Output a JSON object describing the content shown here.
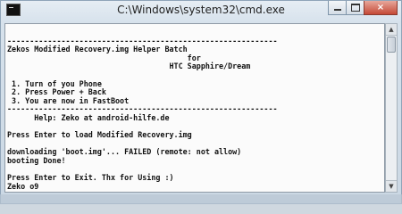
{
  "window": {
    "title": "C:\\Windows\\system32\\cmd.exe",
    "icon": "cmd-icon",
    "controls": {
      "minimize": "minimize-icon",
      "maximize": "maximize-icon",
      "close": "×"
    }
  },
  "console": {
    "lines": [
      "",
      "------------------------------------------------------------",
      "Zekos Modified Recovery.img Helper Batch",
      "                                        for",
      "                                    HTC Sapphire/Dream",
      "",
      " 1. Turn of you Phone",
      " 2. Press Power + Back",
      " 3. You are now in FastBoot",
      "------------------------------------------------------------",
      "      Help: Zeko at android-hilfe.de",
      "",
      "Press Enter to load Modified Recovery.img",
      "",
      "downloading 'boot.img'... FAILED (remote: not allow)",
      "booting Done!",
      "",
      "Press Enter to Exit. Thx for Using :)",
      "Zeko o9"
    ]
  },
  "scrollbar": {
    "up": "▲",
    "down": "▼"
  }
}
